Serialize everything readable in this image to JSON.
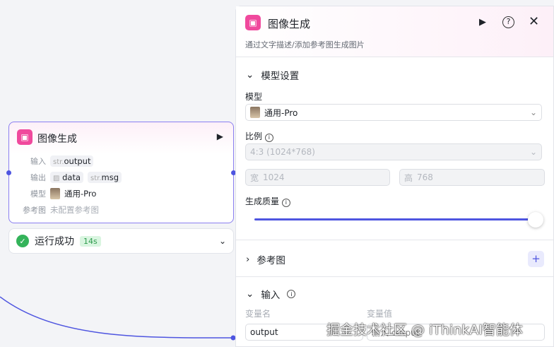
{
  "node": {
    "title": "图像生成",
    "rows": [
      {
        "label": "输入",
        "chips": [
          {
            "type": "str.",
            "name": "output"
          }
        ]
      },
      {
        "label": "输出",
        "chips": [
          {
            "type": "image",
            "name": "data"
          },
          {
            "type": "str.",
            "name": "msg"
          }
        ]
      },
      {
        "label": "模型",
        "value": "通用-Pro"
      },
      {
        "label": "参考图",
        "value": "未配置参考图"
      }
    ]
  },
  "status": {
    "text": "运行成功",
    "time": "14s"
  },
  "panel": {
    "title": "图像生成",
    "subtitle": "通过文字描述/添加参考图生成图片",
    "model_section": "模型设置",
    "model_label": "模型",
    "model_value": "通用-Pro",
    "ratio_label": "比例",
    "ratio_value": "4:3 (1024*768)",
    "width_prefix": "宽",
    "width": "1024",
    "height_prefix": "高",
    "height": "768",
    "quality_label": "生成质量",
    "quality_value": 1.0,
    "ref_section": "参考图",
    "input_section": "输入",
    "var_name_label": "变量名",
    "var_value_label": "变量值",
    "var_name": "output",
    "var_value": "输入 output"
  },
  "watermark": "掘金技术社区 @ iThinkAI智能体"
}
